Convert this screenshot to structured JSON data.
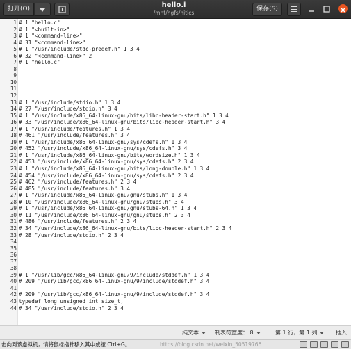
{
  "header": {
    "open_label": "打开(O)",
    "title": "hello.i",
    "subtitle": "/mnt/hgfs/hitics",
    "save_label": "保存(S)"
  },
  "editor": {
    "lines": [
      {
        "n": "1",
        "t": "# 1 \"hello.c\""
      },
      {
        "n": "2",
        "t": "# 1 \"<built-in>\""
      },
      {
        "n": "3",
        "t": "# 1 \"<command-line>\""
      },
      {
        "n": "4",
        "t": "# 31 \"<command-line>\""
      },
      {
        "n": "5",
        "t": "# 1 \"/usr/include/stdc-predef.h\" 1 3 4"
      },
      {
        "n": "6",
        "t": "# 32 \"<command-line>\" 2"
      },
      {
        "n": "7",
        "t": "# 1 \"hello.c\""
      },
      {
        "n": "8",
        "t": ""
      },
      {
        "n": "9",
        "t": ""
      },
      {
        "n": "10",
        "t": ""
      },
      {
        "n": "11",
        "t": ""
      },
      {
        "n": "12",
        "t": ""
      },
      {
        "n": "13",
        "t": "# 1 \"/usr/include/stdio.h\" 1 3 4"
      },
      {
        "n": "14",
        "t": "# 27 \"/usr/include/stdio.h\" 3 4"
      },
      {
        "n": "15",
        "t": "# 1 \"/usr/include/x86_64-linux-gnu/bits/libc-header-start.h\" 1 3 4"
      },
      {
        "n": "16",
        "t": "# 33 \"/usr/include/x86_64-linux-gnu/bits/libc-header-start.h\" 3 4"
      },
      {
        "n": "17",
        "t": "# 1 \"/usr/include/features.h\" 1 3 4"
      },
      {
        "n": "18",
        "t": "# 461 \"/usr/include/features.h\" 3 4"
      },
      {
        "n": "19",
        "t": "# 1 \"/usr/include/x86_64-linux-gnu/sys/cdefs.h\" 1 3 4"
      },
      {
        "n": "20",
        "t": "# 452 \"/usr/include/x86_64-linux-gnu/sys/cdefs.h\" 3 4"
      },
      {
        "n": "21",
        "t": "# 1 \"/usr/include/x86_64-linux-gnu/bits/wordsize.h\" 1 3 4"
      },
      {
        "n": "22",
        "t": "# 453 \"/usr/include/x86_64-linux-gnu/sys/cdefs.h\" 2 3 4"
      },
      {
        "n": "23",
        "t": "# 1 \"/usr/include/x86_64-linux-gnu/bits/long-double.h\" 1 3 4"
      },
      {
        "n": "24",
        "t": "# 454 \"/usr/include/x86_64-linux-gnu/sys/cdefs.h\" 2 3 4"
      },
      {
        "n": "25",
        "t": "# 462 \"/usr/include/features.h\" 2 3 4"
      },
      {
        "n": "26",
        "t": "# 485 \"/usr/include/features.h\" 3 4"
      },
      {
        "n": "27",
        "t": "# 1 \"/usr/include/x86_64-linux-gnu/gnu/stubs.h\" 1 3 4"
      },
      {
        "n": "28",
        "t": "# 10 \"/usr/include/x86_64-linux-gnu/gnu/stubs.h\" 3 4"
      },
      {
        "n": "29",
        "t": "# 1 \"/usr/include/x86_64-linux-gnu/gnu/stubs-64.h\" 1 3 4"
      },
      {
        "n": "30",
        "t": "# 11 \"/usr/include/x86_64-linux-gnu/gnu/stubs.h\" 2 3 4"
      },
      {
        "n": "31",
        "t": "# 486 \"/usr/include/features.h\" 2 3 4"
      },
      {
        "n": "32",
        "t": "# 34 \"/usr/include/x86_64-linux-gnu/bits/libc-header-start.h\" 2 3 4"
      },
      {
        "n": "33",
        "t": "# 28 \"/usr/include/stdio.h\" 2 3 4"
      },
      {
        "n": "34",
        "t": ""
      },
      {
        "n": "35",
        "t": ""
      },
      {
        "n": "36",
        "t": ""
      },
      {
        "n": "37",
        "t": ""
      },
      {
        "n": "38",
        "t": ""
      },
      {
        "n": "39",
        "t": "# 1 \"/usr/lib/gcc/x86_64-linux-gnu/9/include/stddef.h\" 1 3 4"
      },
      {
        "n": "40",
        "t": "# 209 \"/usr/lib/gcc/x86_64-linux-gnu/9/include/stddef.h\" 3 4"
      },
      {
        "n": "41",
        "t": ""
      },
      {
        "n": "42",
        "t": "# 209 \"/usr/lib/gcc/x86_64-linux-gnu/9/include/stddef.h\" 3 4"
      },
      {
        "n": "43",
        "t": "typedef long unsigned int size_t;"
      },
      {
        "n": "44",
        "t": "# 34 \"/usr/include/stdio.h\" 2 3 4"
      }
    ]
  },
  "statusbar": {
    "language": "纯文本",
    "tab_width": "制表符宽度： 8",
    "position": "第 1 行，第 1 列",
    "mode": "插入"
  },
  "hintbar": {
    "text": "击向到该虚拟机，请将鼠标指针移入其中或按 Ctrl+G。",
    "watermark": "https://blog.csdn.net/weixin_50519766"
  }
}
